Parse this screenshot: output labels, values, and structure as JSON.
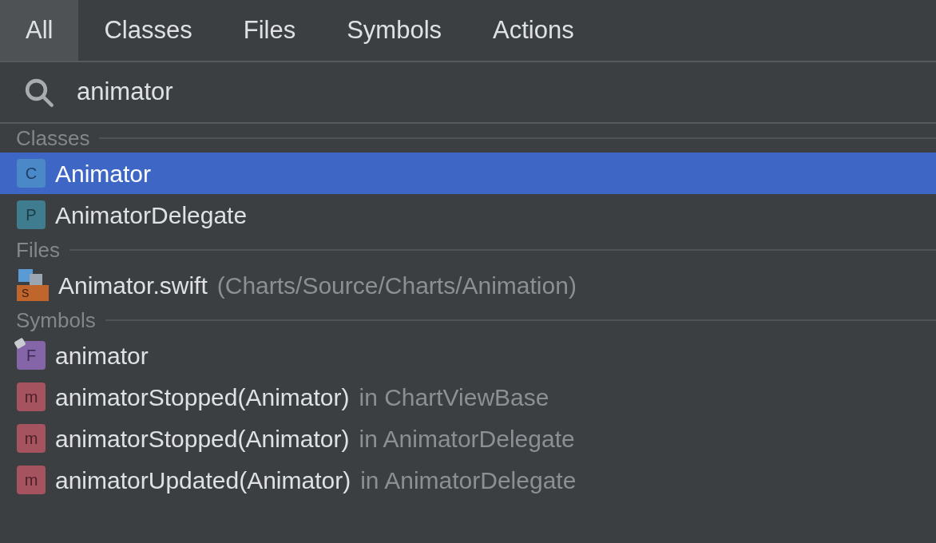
{
  "tabs": [
    {
      "label": "All",
      "selected": true
    },
    {
      "label": "Classes",
      "selected": false
    },
    {
      "label": "Files",
      "selected": false
    },
    {
      "label": "Symbols",
      "selected": false
    },
    {
      "label": "Actions",
      "selected": false
    }
  ],
  "search": {
    "value": "animator"
  },
  "sections": [
    {
      "title": "Classes",
      "items": [
        {
          "kind": "class",
          "badge": "C",
          "name": "Animator",
          "selected": true
        },
        {
          "kind": "protocol",
          "badge": "P",
          "name": "AnimatorDelegate",
          "selected": false
        }
      ]
    },
    {
      "title": "Files",
      "items": [
        {
          "kind": "file",
          "badge": "S",
          "name": "Animator.swift",
          "detail": "(Charts/Source/Charts/Animation)",
          "selected": false
        }
      ]
    },
    {
      "title": "Symbols",
      "items": [
        {
          "kind": "field",
          "badge": "F",
          "name": "animator",
          "selected": false
        },
        {
          "kind": "method",
          "badge": "m",
          "name": "animatorStopped(Animator)",
          "detail": "in ChartViewBase",
          "selected": false
        },
        {
          "kind": "method",
          "badge": "m",
          "name": "animatorStopped(Animator)",
          "detail": "in AnimatorDelegate",
          "selected": false
        },
        {
          "kind": "method",
          "badge": "m",
          "name": "animatorUpdated(Animator)",
          "detail": "in AnimatorDelegate",
          "selected": false
        }
      ]
    }
  ]
}
